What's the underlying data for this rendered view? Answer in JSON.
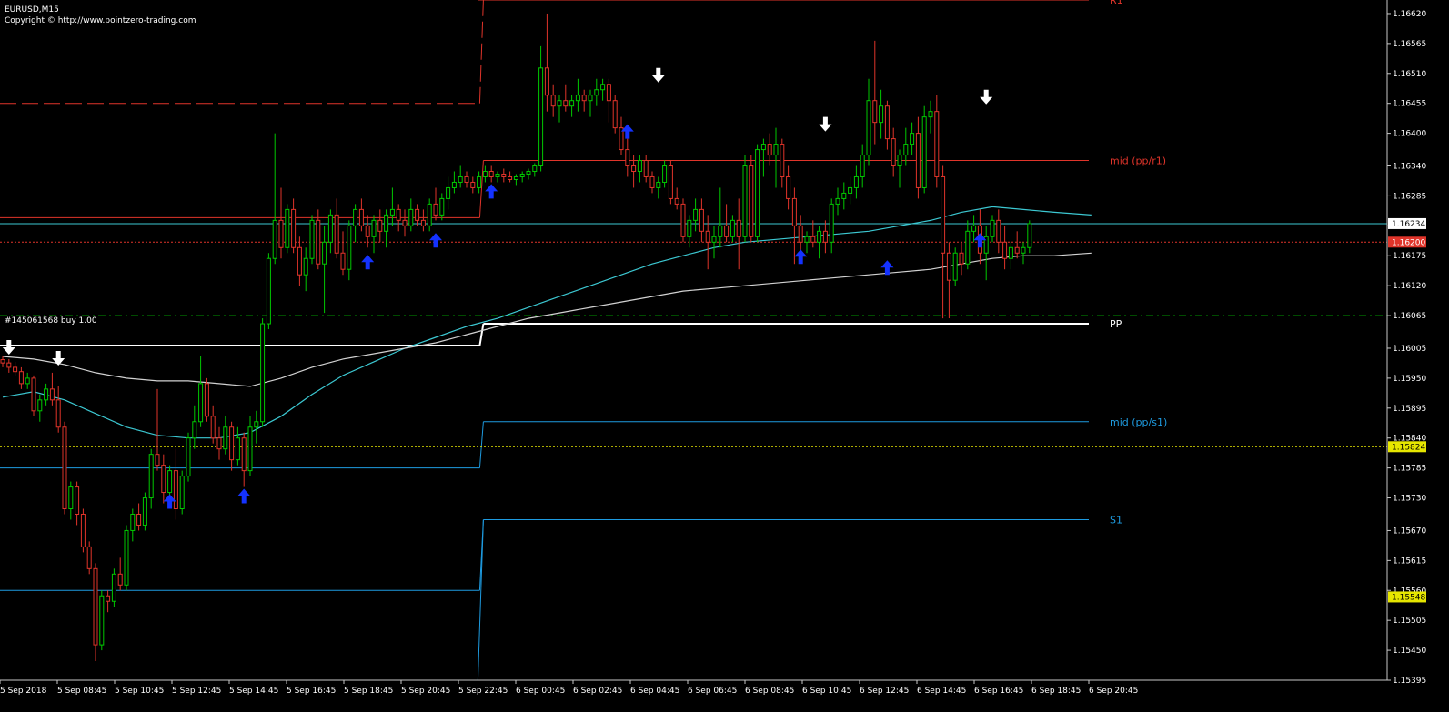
{
  "header": {
    "symbol": "EURUSD,M15",
    "copyright": "Copyright © http://www.pointzero-trading.com"
  },
  "order_label": "#145061568 buy 1.00",
  "levels": [
    {
      "name": "R1",
      "label": "R1",
      "color": "#e0342a"
    },
    {
      "name": "mid_pp_r1",
      "label": "mid (pp/r1)",
      "color": "#e0342a"
    },
    {
      "name": "PP",
      "label": "PP",
      "color": "#ffffff"
    },
    {
      "name": "mid_pp_s1",
      "label": "mid (pp/s1)",
      "color": "#1e9be0"
    },
    {
      "name": "S1",
      "label": "S1",
      "color": "#1e9be0"
    }
  ],
  "price_axis": {
    "ticks": [
      "1.16620",
      "1.16565",
      "1.16510",
      "1.16455",
      "1.16400",
      "1.16340",
      "1.16285",
      "1.16230",
      "1.16175",
      "1.16120",
      "1.16065",
      "1.16005",
      "1.15950",
      "1.15895",
      "1.15840",
      "1.15785",
      "1.15730",
      "1.15670",
      "1.15615",
      "1.15560",
      "1.15505",
      "1.15450",
      "1.15395"
    ],
    "current_price": "1.16234",
    "alert_price_red": "1.16200",
    "alert_price_yellow_1": "1.15824",
    "alert_price_yellow_2": "1.15548"
  },
  "time_axis": {
    "ticks": [
      "5 Sep 2018",
      "5 Sep 08:45",
      "5 Sep 10:45",
      "5 Sep 12:45",
      "5 Sep 14:45",
      "5 Sep 16:45",
      "5 Sep 18:45",
      "5 Sep 20:45",
      "5 Sep 22:45",
      "6 Sep 00:45",
      "6 Sep 02:45",
      "6 Sep 04:45",
      "6 Sep 06:45",
      "6 Sep 08:45",
      "6 Sep 10:45",
      "6 Sep 12:45",
      "6 Sep 14:45",
      "6 Sep 16:45",
      "6 Sep 18:45",
      "6 Sep 20:45"
    ]
  },
  "colors": {
    "background": "#000000",
    "bull": "#00c800",
    "bear": "#e0342a",
    "ma_fast": "#3cc8d2",
    "ma_slow": "#d2d2d2",
    "arrow_up": "#1432ff",
    "arrow_down": "#ffffff"
  },
  "chart_data": {
    "type": "candlestick",
    "title": "EURUSD,M15",
    "ylim": [
      1.1539,
      1.16645
    ],
    "candles": [
      [
        1.15984,
        1.1599,
        1.1597,
        1.15978
      ],
      [
        1.15978,
        1.15985,
        1.1596,
        1.1597
      ],
      [
        1.1597,
        1.1598,
        1.15955,
        1.15962
      ],
      [
        1.15962,
        1.1597,
        1.1593,
        1.1594
      ],
      [
        1.1594,
        1.1596,
        1.1593,
        1.1595
      ],
      [
        1.1595,
        1.15955,
        1.1588,
        1.1589
      ],
      [
        1.1589,
        1.1592,
        1.1587,
        1.1591
      ],
      [
        1.1591,
        1.1594,
        1.159,
        1.1593
      ],
      [
        1.1593,
        1.1596,
        1.159,
        1.1591
      ],
      [
        1.1591,
        1.15935,
        1.1585,
        1.1586
      ],
      [
        1.1586,
        1.1587,
        1.157,
        1.1571
      ],
      [
        1.1571,
        1.1576,
        1.1569,
        1.1575
      ],
      [
        1.1575,
        1.1576,
        1.1568,
        1.157
      ],
      [
        1.157,
        1.1571,
        1.1563,
        1.1564
      ],
      [
        1.1564,
        1.1565,
        1.1559,
        1.156
      ],
      [
        1.156,
        1.1561,
        1.1543,
        1.1546
      ],
      [
        1.1546,
        1.1556,
        1.1545,
        1.1555
      ],
      [
        1.1555,
        1.1556,
        1.1552,
        1.1554
      ],
      [
        1.1554,
        1.156,
        1.1553,
        1.1559
      ],
      [
        1.1559,
        1.1562,
        1.1556,
        1.1557
      ],
      [
        1.1557,
        1.1568,
        1.1556,
        1.1567
      ],
      [
        1.1567,
        1.1571,
        1.1565,
        1.157
      ],
      [
        1.157,
        1.1572,
        1.1567,
        1.1568
      ],
      [
        1.1568,
        1.1574,
        1.1567,
        1.1573
      ],
      [
        1.1573,
        1.1582,
        1.1571,
        1.1581
      ],
      [
        1.1581,
        1.1593,
        1.1578,
        1.1579
      ],
      [
        1.1579,
        1.1581,
        1.1572,
        1.1574
      ],
      [
        1.1574,
        1.1579,
        1.1572,
        1.1578
      ],
      [
        1.1578,
        1.1582,
        1.1569,
        1.1571
      ],
      [
        1.1571,
        1.1578,
        1.157,
        1.1577
      ],
      [
        1.1577,
        1.1585,
        1.1576,
        1.1584
      ],
      [
        1.1584,
        1.159,
        1.1582,
        1.1587
      ],
      [
        1.1587,
        1.1599,
        1.1586,
        1.1594
      ],
      [
        1.1594,
        1.1595,
        1.1587,
        1.1588
      ],
      [
        1.1588,
        1.159,
        1.1583,
        1.1584
      ],
      [
        1.1584,
        1.1586,
        1.158,
        1.1582
      ],
      [
        1.1582,
        1.1588,
        1.1581,
        1.1586
      ],
      [
        1.1586,
        1.1587,
        1.1578,
        1.158
      ],
      [
        1.158,
        1.1586,
        1.1579,
        1.1584
      ],
      [
        1.1584,
        1.1585,
        1.1575,
        1.1578
      ],
      [
        1.1578,
        1.1588,
        1.1577,
        1.1586
      ],
      [
        1.1586,
        1.1589,
        1.1583,
        1.1587
      ],
      [
        1.1587,
        1.1606,
        1.1586,
        1.1605
      ],
      [
        1.1605,
        1.1618,
        1.1604,
        1.1617
      ],
      [
        1.1617,
        1.164,
        1.1616,
        1.1624
      ],
      [
        1.1624,
        1.163,
        1.1617,
        1.1619
      ],
      [
        1.1619,
        1.1627,
        1.1618,
        1.1626
      ],
      [
        1.1626,
        1.1628,
        1.1618,
        1.1619
      ],
      [
        1.1619,
        1.1621,
        1.1612,
        1.1614
      ],
      [
        1.1614,
        1.1619,
        1.1611,
        1.1617
      ],
      [
        1.1617,
        1.1625,
        1.1616,
        1.1624
      ],
      [
        1.1624,
        1.1626,
        1.1615,
        1.1616
      ],
      [
        1.1616,
        1.1623,
        1.1607,
        1.162
      ],
      [
        1.162,
        1.1626,
        1.1618,
        1.1625
      ],
      [
        1.1625,
        1.1628,
        1.1617,
        1.1618
      ],
      [
        1.1618,
        1.1622,
        1.1614,
        1.1615
      ],
      [
        1.1615,
        1.1624,
        1.1613,
        1.1623
      ],
      [
        1.1623,
        1.1627,
        1.162,
        1.1626
      ],
      [
        1.1626,
        1.1628,
        1.1622,
        1.1623
      ],
      [
        1.1623,
        1.1625,
        1.1619,
        1.1621
      ],
      [
        1.1621,
        1.1625,
        1.1618,
        1.1624
      ],
      [
        1.1624,
        1.1626,
        1.162,
        1.1622
      ],
      [
        1.1622,
        1.1626,
        1.1619,
        1.1625
      ],
      [
        1.1625,
        1.163,
        1.1623,
        1.1626
      ],
      [
        1.1626,
        1.1627,
        1.1622,
        1.1624
      ],
      [
        1.1624,
        1.1626,
        1.1621,
        1.1623
      ],
      [
        1.1623,
        1.1628,
        1.1622,
        1.1626
      ],
      [
        1.1626,
        1.1627,
        1.1623,
        1.1624
      ],
      [
        1.1624,
        1.1626,
        1.1622,
        1.1623
      ],
      [
        1.1623,
        1.1628,
        1.1622,
        1.1627
      ],
      [
        1.1627,
        1.163,
        1.1624,
        1.1625
      ],
      [
        1.1625,
        1.1629,
        1.1624,
        1.1628
      ],
      [
        1.1628,
        1.1632,
        1.1626,
        1.163
      ],
      [
        1.163,
        1.1633,
        1.1629,
        1.1631
      ],
      [
        1.1631,
        1.1634,
        1.163,
        1.1632
      ],
      [
        1.1632,
        1.1633,
        1.163,
        1.1631
      ],
      [
        1.1631,
        1.1632,
        1.1629,
        1.163
      ],
      [
        1.163,
        1.1633,
        1.1629,
        1.1632
      ],
      [
        1.1632,
        1.1634,
        1.1631,
        1.1633
      ],
      [
        1.1633,
        1.1634,
        1.1631,
        1.1632
      ],
      [
        1.1632,
        1.1633,
        1.1631,
        1.16325
      ],
      [
        1.16325,
        1.16335,
        1.1631,
        1.1632
      ],
      [
        1.1632,
        1.1633,
        1.1631,
        1.16315
      ],
      [
        1.16315,
        1.16325,
        1.16305,
        1.1632
      ],
      [
        1.1632,
        1.1633,
        1.1631,
        1.16325
      ],
      [
        1.16325,
        1.16335,
        1.16315,
        1.1633
      ],
      [
        1.1633,
        1.16345,
        1.1632,
        1.1634
      ],
      [
        1.1634,
        1.1656,
        1.1633,
        1.1652
      ],
      [
        1.1652,
        1.1662,
        1.1644,
        1.1647
      ],
      [
        1.1647,
        1.1649,
        1.1643,
        1.1645
      ],
      [
        1.1645,
        1.1647,
        1.1642,
        1.1646
      ],
      [
        1.1646,
        1.1649,
        1.1644,
        1.1645
      ],
      [
        1.1645,
        1.1647,
        1.1643,
        1.1646
      ],
      [
        1.1646,
        1.165,
        1.1644,
        1.1647
      ],
      [
        1.1647,
        1.1648,
        1.1644,
        1.1646
      ],
      [
        1.1646,
        1.1648,
        1.1643,
        1.1647
      ],
      [
        1.1647,
        1.165,
        1.1645,
        1.1648
      ],
      [
        1.1648,
        1.165,
        1.1646,
        1.1649
      ],
      [
        1.1649,
        1.165,
        1.1642,
        1.1646
      ],
      [
        1.1646,
        1.1647,
        1.164,
        1.1641
      ],
      [
        1.1641,
        1.1643,
        1.1636,
        1.1637
      ],
      [
        1.1637,
        1.1639,
        1.1632,
        1.1634
      ],
      [
        1.1634,
        1.1636,
        1.163,
        1.1633
      ],
      [
        1.1633,
        1.1636,
        1.1631,
        1.1635
      ],
      [
        1.1635,
        1.1636,
        1.1631,
        1.1632
      ],
      [
        1.1632,
        1.1633,
        1.1629,
        1.163
      ],
      [
        1.163,
        1.1632,
        1.1628,
        1.1631
      ],
      [
        1.1631,
        1.1635,
        1.163,
        1.1634
      ],
      [
        1.1634,
        1.1635,
        1.1627,
        1.1628
      ],
      [
        1.1628,
        1.163,
        1.1626,
        1.1627
      ],
      [
        1.1627,
        1.1628,
        1.162,
        1.1621
      ],
      [
        1.1621,
        1.1625,
        1.1619,
        1.1624
      ],
      [
        1.1624,
        1.1628,
        1.1622,
        1.1626
      ],
      [
        1.1626,
        1.1628,
        1.162,
        1.1622
      ],
      [
        1.1622,
        1.1625,
        1.1615,
        1.162
      ],
      [
        1.162,
        1.1623,
        1.1617,
        1.1621
      ],
      [
        1.1621,
        1.163,
        1.1619,
        1.1623
      ],
      [
        1.1623,
        1.1627,
        1.162,
        1.1621
      ],
      [
        1.1621,
        1.1625,
        1.162,
        1.1624
      ],
      [
        1.1624,
        1.1628,
        1.1615,
        1.1621
      ],
      [
        1.1621,
        1.1636,
        1.162,
        1.1634
      ],
      [
        1.1634,
        1.1636,
        1.162,
        1.1621
      ],
      [
        1.1621,
        1.1638,
        1.162,
        1.1637
      ],
      [
        1.1637,
        1.1639,
        1.1632,
        1.1638
      ],
      [
        1.1638,
        1.164,
        1.1634,
        1.1636
      ],
      [
        1.1636,
        1.1641,
        1.163,
        1.1638
      ],
      [
        1.1638,
        1.1639,
        1.163,
        1.1632
      ],
      [
        1.1632,
        1.1634,
        1.1626,
        1.1628
      ],
      [
        1.1628,
        1.163,
        1.1616,
        1.1623
      ],
      [
        1.1623,
        1.1625,
        1.1618,
        1.162
      ],
      [
        1.162,
        1.1622,
        1.1618,
        1.1621
      ],
      [
        1.1621,
        1.1624,
        1.1619,
        1.162
      ],
      [
        1.162,
        1.1623,
        1.1617,
        1.1622
      ],
      [
        1.1622,
        1.1624,
        1.1618,
        1.162
      ],
      [
        1.162,
        1.1628,
        1.1618,
        1.1627
      ],
      [
        1.1627,
        1.163,
        1.1625,
        1.1628
      ],
      [
        1.1628,
        1.1631,
        1.1626,
        1.1629
      ],
      [
        1.1629,
        1.1632,
        1.1627,
        1.163
      ],
      [
        1.163,
        1.1634,
        1.1628,
        1.1632
      ],
      [
        1.1632,
        1.1638,
        1.163,
        1.1636
      ],
      [
        1.1636,
        1.165,
        1.1634,
        1.1646
      ],
      [
        1.1646,
        1.1657,
        1.1638,
        1.1642
      ],
      [
        1.1642,
        1.1648,
        1.1639,
        1.1645
      ],
      [
        1.1645,
        1.1646,
        1.1637,
        1.1639
      ],
      [
        1.1639,
        1.1641,
        1.1632,
        1.1634
      ],
      [
        1.1634,
        1.1637,
        1.163,
        1.1636
      ],
      [
        1.1636,
        1.1641,
        1.1634,
        1.1638
      ],
      [
        1.1638,
        1.1642,
        1.1636,
        1.164
      ],
      [
        1.164,
        1.1643,
        1.1628,
        1.163
      ],
      [
        1.163,
        1.1645,
        1.1629,
        1.1643
      ],
      [
        1.1643,
        1.1646,
        1.164,
        1.1644
      ],
      [
        1.1644,
        1.1647,
        1.163,
        1.1632
      ],
      [
        1.1632,
        1.1634,
        1.1606,
        1.1618
      ],
      [
        1.1618,
        1.162,
        1.1606,
        1.1613
      ],
      [
        1.1613,
        1.1619,
        1.1612,
        1.1618
      ],
      [
        1.1618,
        1.162,
        1.1614,
        1.1616
      ],
      [
        1.1616,
        1.1624,
        1.1615,
        1.1622
      ],
      [
        1.1622,
        1.1625,
        1.162,
        1.1623
      ],
      [
        1.1623,
        1.1626,
        1.1616,
        1.1618
      ],
      [
        1.1618,
        1.1623,
        1.1613,
        1.1621
      ],
      [
        1.1621,
        1.1625,
        1.162,
        1.1624
      ],
      [
        1.1624,
        1.1626,
        1.1618,
        1.162
      ],
      [
        1.162,
        1.1623,
        1.1615,
        1.1617
      ],
      [
        1.1617,
        1.162,
        1.1615,
        1.1619
      ],
      [
        1.1619,
        1.1622,
        1.1617,
        1.1618
      ],
      [
        1.1618,
        1.162,
        1.1616,
        1.1619
      ],
      [
        1.1619,
        1.1624,
        1.1618,
        1.16234
      ]
    ],
    "ma_fast": [
      [
        0,
        1.15915
      ],
      [
        5,
        1.15925
      ],
      [
        10,
        1.1591
      ],
      [
        15,
        1.15885
      ],
      [
        20,
        1.1586
      ],
      [
        25,
        1.15845
      ],
      [
        30,
        1.1584
      ],
      [
        35,
        1.1584
      ],
      [
        40,
        1.1585
      ],
      [
        45,
        1.1588
      ],
      [
        50,
        1.1592
      ],
      [
        55,
        1.15955
      ],
      [
        60,
        1.1598
      ],
      [
        65,
        1.16005
      ],
      [
        70,
        1.16025
      ],
      [
        75,
        1.16045
      ],
      [
        80,
        1.1606
      ],
      [
        85,
        1.1608
      ],
      [
        90,
        1.161
      ],
      [
        95,
        1.1612
      ],
      [
        100,
        1.1614
      ],
      [
        105,
        1.1616
      ],
      [
        110,
        1.16175
      ],
      [
        115,
        1.1619
      ],
      [
        120,
        1.162
      ],
      [
        125,
        1.16205
      ],
      [
        130,
        1.1621
      ],
      [
        135,
        1.16215
      ],
      [
        140,
        1.1622
      ],
      [
        145,
        1.1623
      ],
      [
        150,
        1.1624
      ],
      [
        155,
        1.16255
      ],
      [
        160,
        1.16265
      ],
      [
        165,
        1.1626
      ],
      [
        170,
        1.16255
      ],
      [
        176,
        1.1625
      ]
    ],
    "ma_slow": [
      [
        0,
        1.1599
      ],
      [
        5,
        1.15985
      ],
      [
        10,
        1.15975
      ],
      [
        15,
        1.1596
      ],
      [
        20,
        1.1595
      ],
      [
        25,
        1.15945
      ],
      [
        30,
        1.15945
      ],
      [
        35,
        1.1594
      ],
      [
        40,
        1.15935
      ],
      [
        45,
        1.1595
      ],
      [
        50,
        1.1597
      ],
      [
        55,
        1.15985
      ],
      [
        60,
        1.15995
      ],
      [
        65,
        1.16005
      ],
      [
        70,
        1.16015
      ],
      [
        75,
        1.1603
      ],
      [
        80,
        1.16045
      ],
      [
        85,
        1.1606
      ],
      [
        90,
        1.1607
      ],
      [
        95,
        1.1608
      ],
      [
        100,
        1.1609
      ],
      [
        105,
        1.161
      ],
      [
        110,
        1.1611
      ],
      [
        115,
        1.16115
      ],
      [
        120,
        1.1612
      ],
      [
        125,
        1.16125
      ],
      [
        130,
        1.1613
      ],
      [
        135,
        1.16135
      ],
      [
        140,
        1.1614
      ],
      [
        145,
        1.16145
      ],
      [
        150,
        1.1615
      ],
      [
        155,
        1.1616
      ],
      [
        160,
        1.1617
      ],
      [
        165,
        1.16175
      ],
      [
        170,
        1.16175
      ],
      [
        176,
        1.1618
      ]
    ],
    "arrows_up": [
      [
        27,
        1.1572
      ],
      [
        39,
        1.1573
      ],
      [
        59,
        1.1616
      ],
      [
        70,
        1.162
      ],
      [
        79,
        1.1629
      ],
      [
        101,
        1.164
      ],
      [
        129,
        1.1617
      ],
      [
        143,
        1.1615
      ],
      [
        158,
        1.162
      ]
    ],
    "arrows_down": [
      [
        1,
        1.1601
      ],
      [
        9,
        1.1599
      ],
      [
        106,
        1.1651
      ],
      [
        133,
        1.1642
      ],
      [
        159,
        1.1647
      ]
    ],
    "levels_prev_day": {
      "R1": 1.16455,
      "mid_pp_r1": 1.16245,
      "PP": 1.1601,
      "mid_pp_s1": 1.15785,
      "S1": 1.1556
    },
    "levels_today": {
      "R1": 1.16645,
      "mid_pp_r1": 1.1635,
      "PP": 1.1605,
      "mid_pp_s1": 1.1587,
      "S1": 1.1569
    },
    "level_switch_index": 78,
    "hlines": {
      "current": 1.16234,
      "alert_red": 1.162,
      "order": 1.16065,
      "yellow_1": 1.15824,
      "yellow_2": 1.15548
    }
  }
}
